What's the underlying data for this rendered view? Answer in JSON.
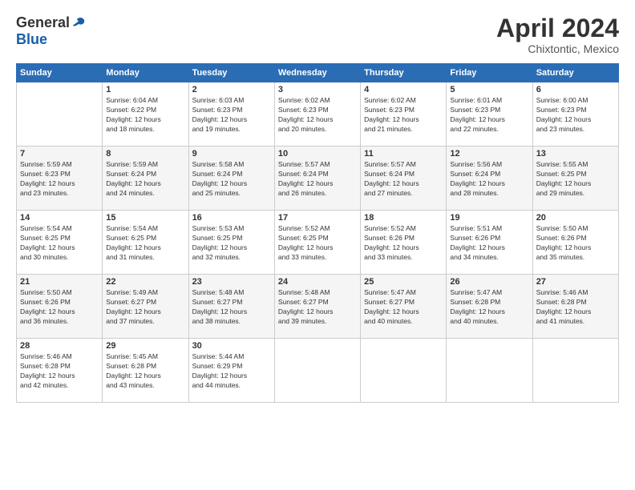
{
  "header": {
    "logo_general": "General",
    "logo_blue": "Blue",
    "title": "April 2024",
    "subtitle": "Chixtontic, Mexico"
  },
  "columns": [
    "Sunday",
    "Monday",
    "Tuesday",
    "Wednesday",
    "Thursday",
    "Friday",
    "Saturday"
  ],
  "weeks": [
    [
      {
        "day": "",
        "detail": ""
      },
      {
        "day": "1",
        "detail": "Sunrise: 6:04 AM\nSunset: 6:22 PM\nDaylight: 12 hours\nand 18 minutes."
      },
      {
        "day": "2",
        "detail": "Sunrise: 6:03 AM\nSunset: 6:23 PM\nDaylight: 12 hours\nand 19 minutes."
      },
      {
        "day": "3",
        "detail": "Sunrise: 6:02 AM\nSunset: 6:23 PM\nDaylight: 12 hours\nand 20 minutes."
      },
      {
        "day": "4",
        "detail": "Sunrise: 6:02 AM\nSunset: 6:23 PM\nDaylight: 12 hours\nand 21 minutes."
      },
      {
        "day": "5",
        "detail": "Sunrise: 6:01 AM\nSunset: 6:23 PM\nDaylight: 12 hours\nand 22 minutes."
      },
      {
        "day": "6",
        "detail": "Sunrise: 6:00 AM\nSunset: 6:23 PM\nDaylight: 12 hours\nand 23 minutes."
      }
    ],
    [
      {
        "day": "7",
        "detail": "Sunrise: 5:59 AM\nSunset: 6:23 PM\nDaylight: 12 hours\nand 23 minutes."
      },
      {
        "day": "8",
        "detail": "Sunrise: 5:59 AM\nSunset: 6:24 PM\nDaylight: 12 hours\nand 24 minutes."
      },
      {
        "day": "9",
        "detail": "Sunrise: 5:58 AM\nSunset: 6:24 PM\nDaylight: 12 hours\nand 25 minutes."
      },
      {
        "day": "10",
        "detail": "Sunrise: 5:57 AM\nSunset: 6:24 PM\nDaylight: 12 hours\nand 26 minutes."
      },
      {
        "day": "11",
        "detail": "Sunrise: 5:57 AM\nSunset: 6:24 PM\nDaylight: 12 hours\nand 27 minutes."
      },
      {
        "day": "12",
        "detail": "Sunrise: 5:56 AM\nSunset: 6:24 PM\nDaylight: 12 hours\nand 28 minutes."
      },
      {
        "day": "13",
        "detail": "Sunrise: 5:55 AM\nSunset: 6:25 PM\nDaylight: 12 hours\nand 29 minutes."
      }
    ],
    [
      {
        "day": "14",
        "detail": "Sunrise: 5:54 AM\nSunset: 6:25 PM\nDaylight: 12 hours\nand 30 minutes."
      },
      {
        "day": "15",
        "detail": "Sunrise: 5:54 AM\nSunset: 6:25 PM\nDaylight: 12 hours\nand 31 minutes."
      },
      {
        "day": "16",
        "detail": "Sunrise: 5:53 AM\nSunset: 6:25 PM\nDaylight: 12 hours\nand 32 minutes."
      },
      {
        "day": "17",
        "detail": "Sunrise: 5:52 AM\nSunset: 6:25 PM\nDaylight: 12 hours\nand 33 minutes."
      },
      {
        "day": "18",
        "detail": "Sunrise: 5:52 AM\nSunset: 6:26 PM\nDaylight: 12 hours\nand 33 minutes."
      },
      {
        "day": "19",
        "detail": "Sunrise: 5:51 AM\nSunset: 6:26 PM\nDaylight: 12 hours\nand 34 minutes."
      },
      {
        "day": "20",
        "detail": "Sunrise: 5:50 AM\nSunset: 6:26 PM\nDaylight: 12 hours\nand 35 minutes."
      }
    ],
    [
      {
        "day": "21",
        "detail": "Sunrise: 5:50 AM\nSunset: 6:26 PM\nDaylight: 12 hours\nand 36 minutes."
      },
      {
        "day": "22",
        "detail": "Sunrise: 5:49 AM\nSunset: 6:27 PM\nDaylight: 12 hours\nand 37 minutes."
      },
      {
        "day": "23",
        "detail": "Sunrise: 5:48 AM\nSunset: 6:27 PM\nDaylight: 12 hours\nand 38 minutes."
      },
      {
        "day": "24",
        "detail": "Sunrise: 5:48 AM\nSunset: 6:27 PM\nDaylight: 12 hours\nand 39 minutes."
      },
      {
        "day": "25",
        "detail": "Sunrise: 5:47 AM\nSunset: 6:27 PM\nDaylight: 12 hours\nand 40 minutes."
      },
      {
        "day": "26",
        "detail": "Sunrise: 5:47 AM\nSunset: 6:28 PM\nDaylight: 12 hours\nand 40 minutes."
      },
      {
        "day": "27",
        "detail": "Sunrise: 5:46 AM\nSunset: 6:28 PM\nDaylight: 12 hours\nand 41 minutes."
      }
    ],
    [
      {
        "day": "28",
        "detail": "Sunrise: 5:46 AM\nSunset: 6:28 PM\nDaylight: 12 hours\nand 42 minutes."
      },
      {
        "day": "29",
        "detail": "Sunrise: 5:45 AM\nSunset: 6:28 PM\nDaylight: 12 hours\nand 43 minutes."
      },
      {
        "day": "30",
        "detail": "Sunrise: 5:44 AM\nSunset: 6:29 PM\nDaylight: 12 hours\nand 44 minutes."
      },
      {
        "day": "",
        "detail": ""
      },
      {
        "day": "",
        "detail": ""
      },
      {
        "day": "",
        "detail": ""
      },
      {
        "day": "",
        "detail": ""
      }
    ]
  ]
}
